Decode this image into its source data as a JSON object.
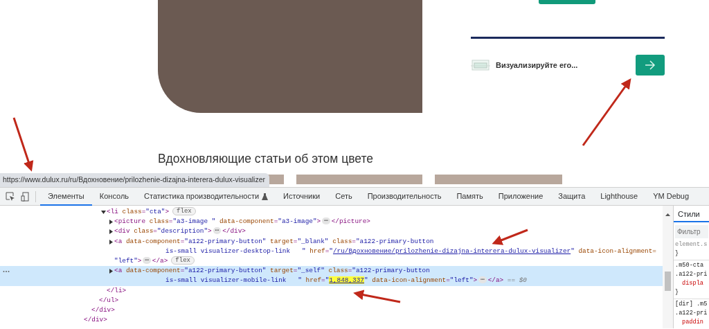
{
  "page": {
    "visualizer_text": "Визуализируйте его...",
    "articles_heading": "Вдохновляющие статьи об этом цвете",
    "thumbnails": [
      {
        "kind": "photo"
      },
      {
        "kind": "photo"
      },
      {
        "kind": "photo"
      }
    ]
  },
  "status_url": "https://www.dulux.ru/ru/Вдохновение/prilozhenie-dizajna-interera-dulux-visualizer",
  "annotations": [
    {
      "kind": "arrow"
    },
    {
      "kind": "arrow"
    },
    {
      "kind": "arrow"
    },
    {
      "kind": "arrow"
    }
  ],
  "devtools": {
    "tabs": [
      {
        "label": "Элементы",
        "selected": true,
        "kind": "plain"
      },
      {
        "label": "Консоль",
        "selected": false,
        "kind": "plain"
      },
      {
        "label": "Статистика производительности",
        "selected": false,
        "kind": "experimental"
      },
      {
        "label": "Источники",
        "selected": false,
        "kind": "plain"
      },
      {
        "label": "Сеть",
        "selected": false,
        "kind": "plain"
      },
      {
        "label": "Производительность",
        "selected": false,
        "kind": "plain"
      },
      {
        "label": "Память",
        "selected": false,
        "kind": "plain"
      },
      {
        "label": "Приложение",
        "selected": false,
        "kind": "plain"
      },
      {
        "label": "Защита",
        "selected": false,
        "kind": "plain"
      },
      {
        "label": "Lighthouse",
        "selected": false,
        "kind": "plain"
      },
      {
        "label": "YM Debug",
        "selected": false,
        "kind": "plain"
      }
    ],
    "dom_tree": [
      {
        "close": [
          {
            "kind": "tag",
            "text": "</div>"
          }
        ],
        "children": [
          {
            "close": [
              {
                "kind": "tag",
                "text": "</div>"
              }
            ],
            "children": [
              {
                "close": [
                  {
                    "kind": "tag",
                    "text": "</ul>"
                  }
                ],
                "children": [
                  {
                    "selected": false,
                    "expanded": true,
                    "lines": [
                      {
                        "segments": [
                          {
                            "kind": "tag",
                            "text": "<li "
                          },
                          {
                            "kind": "attr",
                            "text": "class"
                          },
                          {
                            "kind": "tag",
                            "text": "="
                          },
                          {
                            "kind": "value",
                            "text": "\"cta\""
                          },
                          {
                            "kind": "tag",
                            "text": ">"
                          },
                          {
                            "kind": "badge",
                            "text": "flex"
                          }
                        ]
                      }
                    ],
                    "close": [
                      {
                        "kind": "tag",
                        "text": "</li>"
                      }
                    ],
                    "children": [
                      {
                        "selected": false,
                        "expanded": false,
                        "lines": [
                          {
                            "segments": [
                              {
                                "kind": "tag",
                                "text": "<picture "
                              },
                              {
                                "kind": "attr",
                                "text": "class"
                              },
                              {
                                "kind": "tag",
                                "text": "="
                              },
                              {
                                "kind": "value",
                                "text": "\"a3-image \" "
                              },
                              {
                                "kind": "attr",
                                "text": "data-component"
                              },
                              {
                                "kind": "tag",
                                "text": "="
                              },
                              {
                                "kind": "value",
                                "text": "\"a3-image\""
                              },
                              {
                                "kind": "tag",
                                "text": ">"
                              },
                              {
                                "kind": "ellipsis",
                                "text": "⋯"
                              },
                              {
                                "kind": "tag",
                                "text": "</picture>"
                              }
                            ]
                          }
                        ]
                      },
                      {
                        "selected": false,
                        "expanded": false,
                        "lines": [
                          {
                            "segments": [
                              {
                                "kind": "tag",
                                "text": "<div "
                              },
                              {
                                "kind": "attr",
                                "text": "class"
                              },
                              {
                                "kind": "tag",
                                "text": "="
                              },
                              {
                                "kind": "value",
                                "text": "\"description\""
                              },
                              {
                                "kind": "tag",
                                "text": ">"
                              },
                              {
                                "kind": "ellipsis",
                                "text": "⋯"
                              },
                              {
                                "kind": "tag",
                                "text": "</div>"
                              }
                            ]
                          }
                        ]
                      },
                      {
                        "selected": false,
                        "expanded": false,
                        "lines": [
                          {
                            "segments": [
                              {
                                "kind": "tag",
                                "text": "<a "
                              },
                              {
                                "kind": "attr",
                                "text": "data-component"
                              },
                              {
                                "kind": "tag",
                                "text": "="
                              },
                              {
                                "kind": "value",
                                "text": "\"a122-primary-button\" "
                              },
                              {
                                "kind": "attr",
                                "text": "target"
                              },
                              {
                                "kind": "tag",
                                "text": "="
                              },
                              {
                                "kind": "value",
                                "text": "\"_blank\" "
                              },
                              {
                                "kind": "attr",
                                "text": "class"
                              },
                              {
                                "kind": "tag",
                                "text": "="
                              },
                              {
                                "kind": "value",
                                "text": "\"a122-primary-button"
                              }
                            ]
                          },
                          {
                            "kind": "hang",
                            "segments": [
                              {
                                "kind": "value",
                                "text": "is-small visualizer-desktop-link   \" "
                              },
                              {
                                "kind": "attr",
                                "text": "href"
                              },
                              {
                                "kind": "tag",
                                "text": "="
                              },
                              {
                                "kind": "value",
                                "text": "\""
                              },
                              {
                                "kind": "link",
                                "text": "/ru/Вдохновение/prilozhenie-dizajna-interera-dulux-visualizer"
                              },
                              {
                                "kind": "value",
                                "text": "\" "
                              },
                              {
                                "kind": "attr",
                                "text": "data-icon-alignment="
                              }
                            ]
                          },
                          {
                            "kind": "flush",
                            "segments": [
                              {
                                "kind": "value",
                                "text": "\"left\""
                              },
                              {
                                "kind": "tag",
                                "text": ">"
                              },
                              {
                                "kind": "ellipsis",
                                "text": "⋯"
                              },
                              {
                                "kind": "tag",
                                "text": "</a>"
                              },
                              {
                                "kind": "badge",
                                "text": "flex"
                              }
                            ]
                          }
                        ]
                      },
                      {
                        "selected": true,
                        "expanded": false,
                        "lines": [
                          {
                            "segments": [
                              {
                                "kind": "tag",
                                "text": "<a "
                              },
                              {
                                "kind": "attr",
                                "text": "data-component"
                              },
                              {
                                "kind": "tag",
                                "text": "="
                              },
                              {
                                "kind": "value",
                                "text": "\"a122-primary-button\" "
                              },
                              {
                                "kind": "attr",
                                "text": "target"
                              },
                              {
                                "kind": "tag",
                                "text": "="
                              },
                              {
                                "kind": "value",
                                "text": "\"_self\" "
                              },
                              {
                                "kind": "attr",
                                "text": "class"
                              },
                              {
                                "kind": "tag",
                                "text": "="
                              },
                              {
                                "kind": "value",
                                "text": "\"a122-primary-button"
                              }
                            ]
                          },
                          {
                            "kind": "hang",
                            "segments": [
                              {
                                "kind": "value",
                                "text": "is-small visualizer-mobile-link   \" "
                              },
                              {
                                "kind": "attr",
                                "text": "href"
                              },
                              {
                                "kind": "tag",
                                "text": "="
                              },
                              {
                                "kind": "value",
                                "text": "\""
                              },
                              {
                                "kind": "highlight",
                                "text": "1,848,337"
                              },
                              {
                                "kind": "value",
                                "text": "\" "
                              },
                              {
                                "kind": "attr",
                                "text": "data-icon-alignment"
                              },
                              {
                                "kind": "tag",
                                "text": "="
                              },
                              {
                                "kind": "value",
                                "text": "\"left\""
                              },
                              {
                                "kind": "tag",
                                "text": ">"
                              },
                              {
                                "kind": "ellipsis",
                                "text": "⋯"
                              },
                              {
                                "kind": "tag",
                                "text": "</a>"
                              },
                              {
                                "kind": "dim",
                                "text": " == $0"
                              }
                            ]
                          }
                        ]
                      }
                    ]
                  }
                ]
              }
            ]
          }
        ]
      }
    ],
    "styles": {
      "tab": "Стили",
      "filter_placeholder": "Фильтр",
      "rules": [
        {
          "lines": [
            {
              "kind": "muted",
              "text": "element.s"
            },
            {
              "kind": "brace",
              "text": "}"
            }
          ]
        },
        {
          "lines": [
            {
              "kind": "selector",
              "text": ".m50-cta"
            },
            {
              "kind": "selector",
              "text": ".a122-pri"
            },
            {
              "kind": "property",
              "text": "displa"
            },
            {
              "kind": "brace",
              "text": "}"
            }
          ]
        },
        {
          "lines": [
            {
              "kind": "selector",
              "text": "[dir] .m5"
            },
            {
              "kind": "selector",
              "text": ".a122-pri"
            },
            {
              "kind": "property",
              "text": "paddin"
            }
          ]
        }
      ]
    }
  }
}
